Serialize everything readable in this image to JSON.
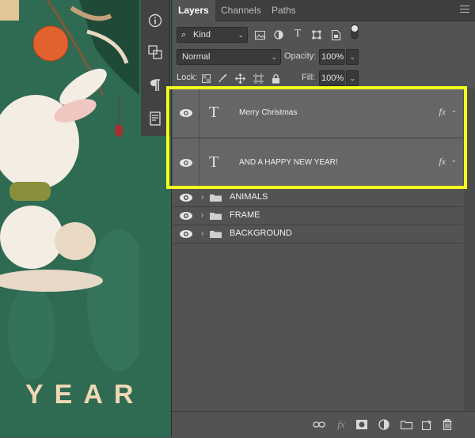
{
  "canvas": {
    "text": "YEAR!"
  },
  "tabs": [
    {
      "label": "Layers"
    },
    {
      "label": "Channels"
    },
    {
      "label": "Paths"
    }
  ],
  "filter": {
    "kind_label": "Kind"
  },
  "blend": {
    "mode": "Normal",
    "opacity_label": "Opacity:",
    "opacity_value": "100%",
    "fill_label": "Fill:",
    "fill_value": "100%",
    "lock_label": "Lock:"
  },
  "layers": [
    {
      "type": "text",
      "name": "Merry Christmas",
      "glyph": "T",
      "fx": "fx"
    },
    {
      "type": "text",
      "name": "AND A HAPPY NEW YEAR!",
      "glyph": "T",
      "fx": "fx"
    },
    {
      "type": "group",
      "name": "ANIMALS"
    },
    {
      "type": "group",
      "name": "FRAME"
    },
    {
      "type": "group",
      "name": "BACKGROUND"
    }
  ],
  "bottom_fx_label": "fx",
  "colors": {
    "highlight": "#f2ff1e",
    "panel_bg": "#535353",
    "selected_row": "#666666",
    "canvas_green": "#2f6a52"
  }
}
